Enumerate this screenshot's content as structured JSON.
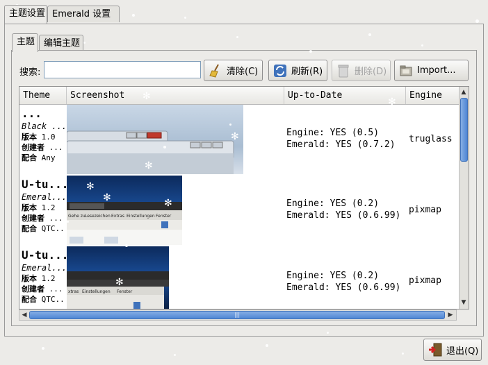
{
  "outer_tabs": [
    "主题设置",
    "Emerald 设置"
  ],
  "inner_tabs": [
    "主题",
    "编辑主题"
  ],
  "search": {
    "label": "搜索:",
    "value": ""
  },
  "toolbar": {
    "clear": "清除(C)",
    "refresh": "刷新(R)",
    "delete": "删除(D)",
    "import": "Import..."
  },
  "columns": [
    "Theme",
    "Screenshot",
    "Up-to-Date",
    "Engine"
  ],
  "themes": [
    {
      "name": "...",
      "desc": "Black ...",
      "version_label": "版本",
      "version": "1.0",
      "creator_label": "创建者",
      "creator": "...",
      "suits_label": "配合",
      "suits": "Any",
      "engine_status": "Engine: YES (0.5)",
      "emerald_status": "Emerald: YES (0.7.2)",
      "engine": "truglass"
    },
    {
      "name": "U-tu...",
      "desc": "Emeral...",
      "version_label": "版本",
      "version": "1.2",
      "creator_label": "创建者",
      "creator": "...",
      "suits_label": "配合",
      "suits": "QTC...",
      "engine_status": "Engine: YES (0.2)",
      "emerald_status": "Emerald: YES (0.6.99)",
      "engine": "pixmap"
    },
    {
      "name": "U-tu...",
      "desc": "Emeral...",
      "version_label": "版本",
      "version": "1.2",
      "creator_label": "创建者",
      "creator": "...",
      "suits_label": "配合",
      "suits": "QTC...",
      "engine_status": "Engine: YES (0.2)",
      "emerald_status": "Emerald: YES (0.6.99)",
      "engine": "pixmap"
    }
  ],
  "preview_text": {
    "menu_items": [
      "Gehe zu",
      "Lesezeichen",
      "Extras",
      "Einstellungen",
      "Fenster"
    ],
    "menu_items_short": [
      "xtras",
      "Einstellungen",
      "Fenster"
    ]
  },
  "quit": "退出(Q)",
  "icons": {
    "clear": "broom-icon",
    "refresh": "refresh-icon",
    "delete": "trash-icon",
    "import": "import-folder-icon",
    "quit": "exit-door-icon"
  }
}
